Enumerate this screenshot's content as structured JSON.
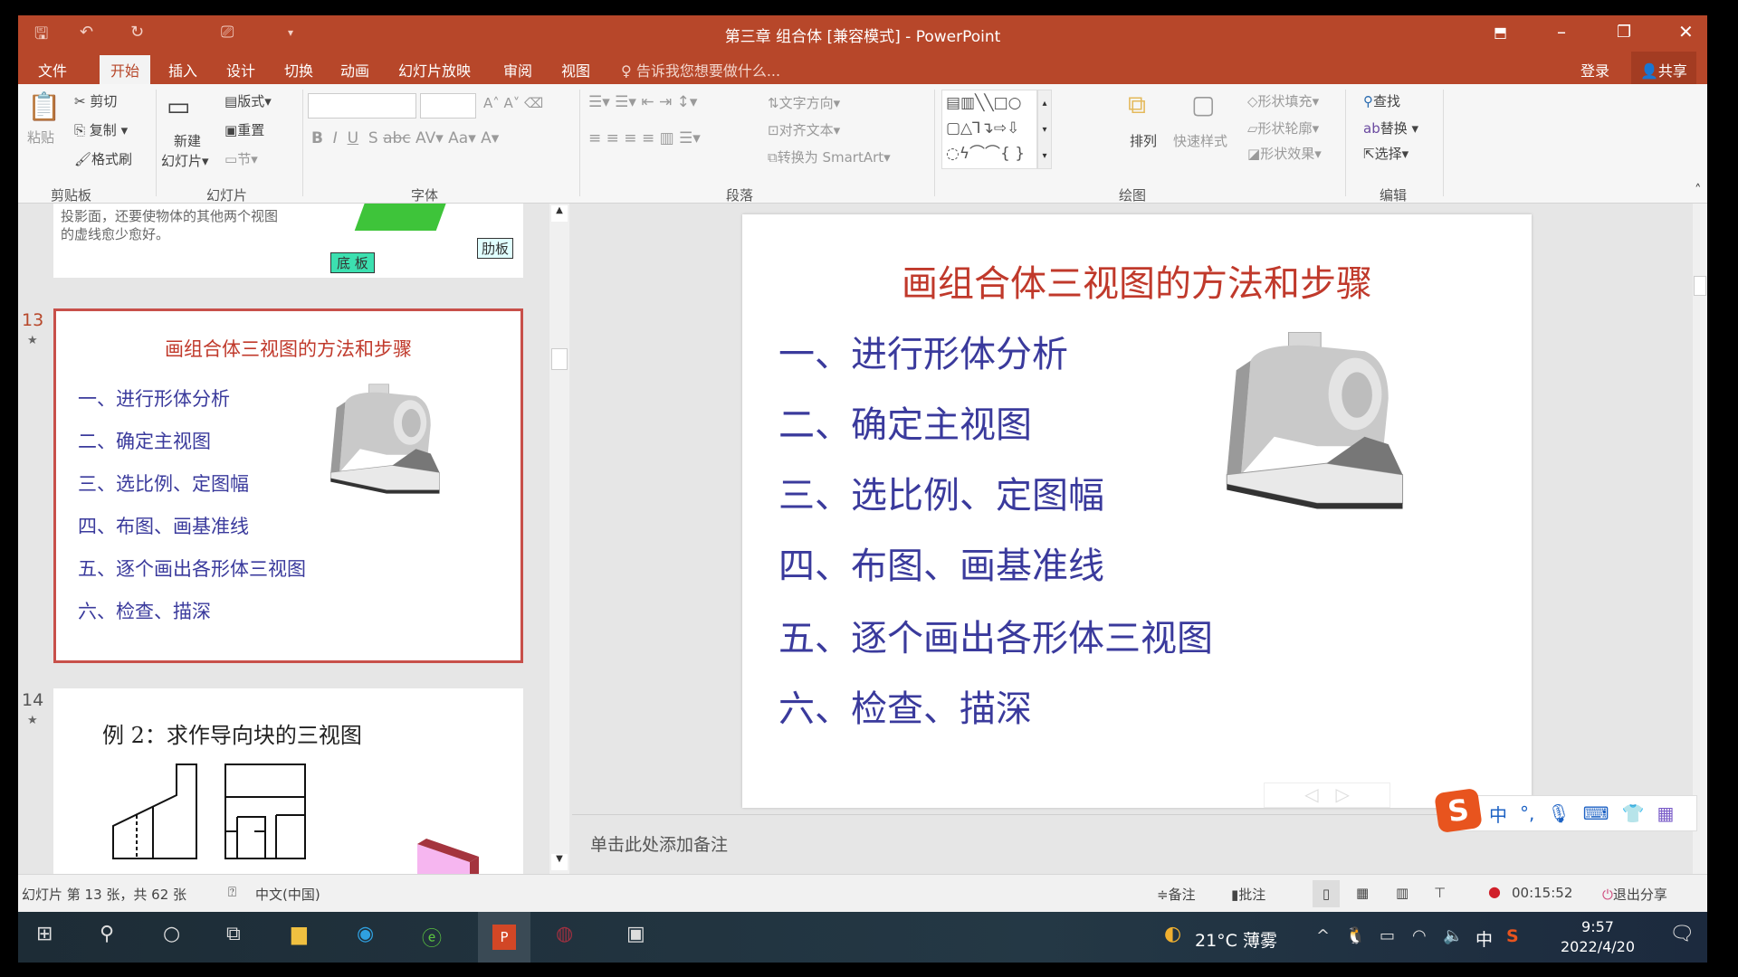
{
  "window": {
    "title": "第三章 组合体 [兼容模式] - PowerPoint",
    "colors": {
      "accent": "#b7472a",
      "slide_title": "#c0392b",
      "slide_list": "#3a3a9c"
    }
  },
  "tabs": [
    {
      "label": "文件"
    },
    {
      "label": "开始",
      "active": true
    },
    {
      "label": "插入"
    },
    {
      "label": "设计"
    },
    {
      "label": "切换"
    },
    {
      "label": "动画"
    },
    {
      "label": "幻灯片放映"
    },
    {
      "label": "审阅"
    },
    {
      "label": "视图"
    }
  ],
  "tell_me": "告诉我您想要做什么...",
  "account": {
    "login": "登录",
    "share": "共享"
  },
  "ribbon": {
    "clipboard": {
      "paste": "粘贴",
      "cut": "剪切",
      "copy": "复制",
      "format_painter": "格式刷",
      "group": "剪贴板"
    },
    "slides": {
      "new_slide_1": "新建",
      "new_slide_2": "幻灯片",
      "layout": "版式",
      "reset": "重置",
      "section": "节",
      "group": "幻灯片"
    },
    "font": {
      "group": "字体",
      "bold": "B",
      "italic": "I",
      "underline": "U",
      "shadow": "S",
      "strike": "abc",
      "spacing": "AV",
      "case": "Aa",
      "color": "A"
    },
    "paragraph": {
      "text_direction": "文字方向",
      "align_text": "对齐文本",
      "smartart": "转换为 SmartArt",
      "group": "段落"
    },
    "drawing": {
      "arrange": "排列",
      "quick_styles": "快速样式",
      "shape_fill": "形状填充",
      "shape_outline": "形状轮廓",
      "shape_effects": "形状效果",
      "group": "绘图"
    },
    "editing": {
      "find": "查找",
      "replace": "替换",
      "select": "选择",
      "group": "编辑"
    }
  },
  "thumbnails": {
    "slide12": {
      "text": [
        "投影面，还要使物体的其他两个视图",
        "的虚线愈少愈好。"
      ],
      "label_base": "底 板",
      "label_rib": "肋板"
    },
    "slide13": {
      "number": "13",
      "title": "画组合体三视图的方法和步骤",
      "items": [
        "一、进行形体分析",
        "二、确定主视图",
        "三、选比例、定图幅",
        "四、布图、画基准线",
        "五、逐个画出各形体三视图",
        "六、检查、描深"
      ]
    },
    "slide14": {
      "number": "14",
      "title": "例 2：求作导向块的三视图"
    }
  },
  "slide": {
    "title": "画组合体三视图的方法和步骤",
    "items": [
      "一、进行形体分析",
      "二、确定主视图",
      "三、选比例、定图幅",
      "四、布图、画基准线",
      "五、逐个画出各形体三视图",
      "六、检查、描深"
    ]
  },
  "notes_placeholder": "单击此处添加备注",
  "status": {
    "slide_info": "幻灯片 第 13 张，共 62 张",
    "language": "中文(中国)",
    "notes": "备注",
    "comments": "批注",
    "timer": "00:15:52",
    "exit_share": "退出分享"
  },
  "ime": {
    "mode": "中",
    "punct": "°,"
  },
  "taskbar": {
    "weather": "21°C 薄雾",
    "ime": "中",
    "time": "9:57",
    "date": "2022/4/20"
  }
}
